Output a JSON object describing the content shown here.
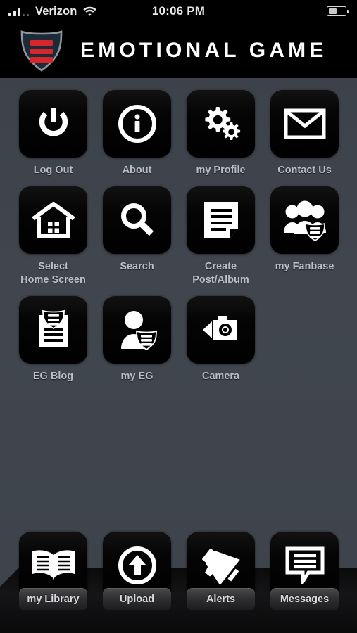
{
  "status_bar": {
    "carrier": "Verizon",
    "signal_icon": "signal-bars-icon",
    "wifi_icon": "wifi-icon",
    "time": "10:06 PM",
    "battery_icon": "battery-icon",
    "battery_percent": 50
  },
  "header": {
    "logo_icon": "shield-logo-icon",
    "title": "EMOTIONAL GAME",
    "logo_colors": {
      "shield_fill": "#1d2a38",
      "shield_border": "#8e969e",
      "bars": "#d8262d"
    }
  },
  "theme": {
    "background_top": "#3b4149",
    "background_bottom": "#3e444b",
    "tile_background": "#000000",
    "label_color": "#b9bfc6",
    "header_background": "#000000"
  },
  "grid": {
    "rows": [
      [
        {
          "label": "Log Out",
          "icon": "power-icon"
        },
        {
          "label": "About",
          "icon": "info-circle-icon"
        },
        {
          "label": "my Profile",
          "icon": "gears-icon"
        },
        {
          "label": "Contact Us",
          "icon": "envelope-icon"
        }
      ],
      [
        {
          "label": "Select\nHome Screen",
          "icon": "home-icon"
        },
        {
          "label": "Search",
          "icon": "magnifier-icon"
        },
        {
          "label": "Create\nPost/Album",
          "icon": "document-icon"
        },
        {
          "label": "my Fanbase",
          "icon": "people-shield-icon"
        }
      ],
      [
        {
          "label": "EG Blog",
          "icon": "blog-shield-icon"
        },
        {
          "label": "my EG",
          "icon": "person-shield-icon"
        },
        {
          "label": "Camera",
          "icon": "camcorder-icon"
        }
      ]
    ]
  },
  "tab_bar": {
    "items": [
      {
        "label": "my Library",
        "icon": "open-book-icon"
      },
      {
        "label": "Upload",
        "icon": "upload-arrow-icon"
      },
      {
        "label": "Alerts",
        "icon": "megaphone-icon"
      },
      {
        "label": "Messages",
        "icon": "speech-bubble-icon"
      }
    ]
  }
}
